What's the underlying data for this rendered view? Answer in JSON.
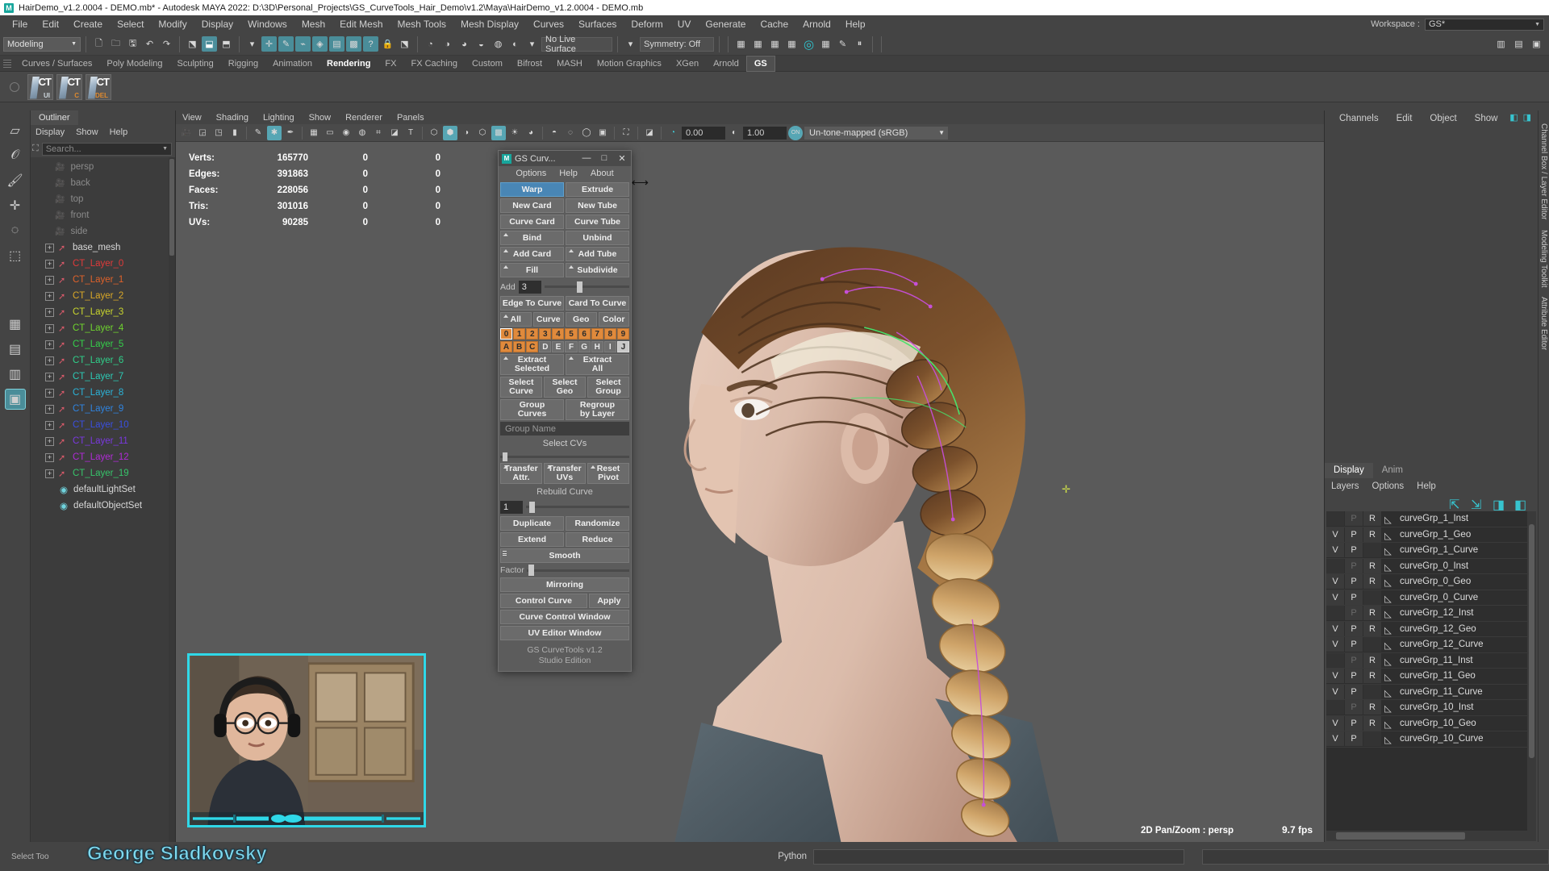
{
  "titlebar": {
    "text": "HairDemo_v1.2.0004 - DEMO.mb* - Autodesk MAYA 2022: D:\\3D\\Personal_Projects\\GS_CurveTools_Hair_Demo\\v1.2\\Maya\\HairDemo_v1.2.0004 - DEMO.mb",
    "logo": "M"
  },
  "menubar": {
    "items": [
      "File",
      "Edit",
      "Create",
      "Select",
      "Modify",
      "Display",
      "Windows",
      "Mesh",
      "Edit Mesh",
      "Mesh Tools",
      "Mesh Display",
      "Curves",
      "Surfaces",
      "Deform",
      "UV",
      "Generate",
      "Cache",
      "Arnold",
      "Help"
    ],
    "workspace_label": "Workspace :",
    "workspace_value": "GS*"
  },
  "toolbar": {
    "mode": "Modeling",
    "live_surface": "No Live Surface",
    "symmetry": "Symmetry: Off"
  },
  "shelf": {
    "tabs": [
      "Curves / Surfaces",
      "Poly Modeling",
      "Sculpting",
      "Rigging",
      "Animation",
      "Rendering",
      "FX",
      "FX Caching",
      "Custom",
      "Bifrost",
      "MASH",
      "Motion Graphics",
      "XGen",
      "Arnold",
      "GS"
    ],
    "active": "GS",
    "bold": "Rendering",
    "buttons": [
      {
        "name": "CT",
        "sub": "UI"
      },
      {
        "name": "CT",
        "sub": "C"
      },
      {
        "name": "CT",
        "sub": "DEL"
      }
    ]
  },
  "outliner": {
    "tab": "Outliner",
    "menus": [
      "Display",
      "Show",
      "Help"
    ],
    "search_placeholder": "Search...",
    "items": [
      {
        "label": "persp",
        "type": "camera",
        "color": "#8b8b8b"
      },
      {
        "label": "back",
        "type": "camera",
        "color": "#8b8b8b"
      },
      {
        "label": "top",
        "type": "camera",
        "color": "#8b8b8b"
      },
      {
        "label": "front",
        "type": "camera",
        "color": "#8b8b8b"
      },
      {
        "label": "side",
        "type": "camera",
        "color": "#8b8b8b"
      },
      {
        "label": "base_mesh",
        "type": "transform",
        "color": "#d8d8d8"
      },
      {
        "label": "CT_Layer_0",
        "type": "transform",
        "color": "#e03a3a"
      },
      {
        "label": "CT_Layer_1",
        "type": "transform",
        "color": "#e0622a"
      },
      {
        "label": "CT_Layer_2",
        "type": "transform",
        "color": "#d9a727"
      },
      {
        "label": "CT_Layer_3",
        "type": "transform",
        "color": "#c9d62e"
      },
      {
        "label": "CT_Layer_4",
        "type": "transform",
        "color": "#6fd42e"
      },
      {
        "label": "CT_Layer_5",
        "type": "transform",
        "color": "#34d04a"
      },
      {
        "label": "CT_Layer_6",
        "type": "transform",
        "color": "#2fd08a"
      },
      {
        "label": "CT_Layer_7",
        "type": "transform",
        "color": "#2cc9b4"
      },
      {
        "label": "CT_Layer_8",
        "type": "transform",
        "color": "#2bb3d8"
      },
      {
        "label": "CT_Layer_9",
        "type": "transform",
        "color": "#2f84e0"
      },
      {
        "label": "CT_Layer_10",
        "type": "transform",
        "color": "#3a4fe0"
      },
      {
        "label": "CT_Layer_11",
        "type": "transform",
        "color": "#7a38e0"
      },
      {
        "label": "CT_Layer_12",
        "type": "transform",
        "color": "#b02ad6"
      },
      {
        "label": "CT_Layer_19",
        "type": "transform",
        "color": "#37c46a"
      },
      {
        "label": "defaultLightSet",
        "type": "set",
        "color": "#d8d8d8"
      },
      {
        "label": "defaultObjectSet",
        "type": "set",
        "color": "#d8d8d8"
      }
    ]
  },
  "viewport": {
    "menus": [
      "View",
      "Shading",
      "Lighting",
      "Show",
      "Renderer",
      "Panels"
    ],
    "exposure": "0.00",
    "gamma": "1.00",
    "tonemap_toggle": "ON",
    "tonemap": "Un-tone-mapped (sRGB)",
    "hud_headers": [
      "",
      "",
      ""
    ],
    "hud": [
      {
        "label": "Verts:",
        "total": "165770",
        "b": "0",
        "c": "0"
      },
      {
        "label": "Edges:",
        "total": "391863",
        "b": "0",
        "c": "0"
      },
      {
        "label": "Faces:",
        "total": "228056",
        "b": "0",
        "c": "0"
      },
      {
        "label": "Tris:",
        "total": "301016",
        "b": "0",
        "c": "0"
      },
      {
        "label": "UVs:",
        "total": "90285",
        "b": "0",
        "c": "0"
      }
    ],
    "panzoom": "2D Pan/Zoom : persp",
    "fps": "9.7 fps"
  },
  "gs_curvetools": {
    "title": "GS Curv...",
    "logo": "M",
    "window_buttons": [
      "—",
      "□",
      "✕"
    ],
    "menus": [
      "Options",
      "Help",
      "About"
    ],
    "rows": [
      {
        "type": "pair",
        "left": {
          "label": "Warp",
          "style": "blue"
        },
        "right": {
          "label": "Extrude"
        }
      },
      {
        "type": "pair",
        "left": {
          "label": "New Card"
        },
        "right": {
          "label": "New Tube"
        }
      },
      {
        "type": "pair",
        "left": {
          "label": "Curve Card"
        },
        "right": {
          "label": "Curve Tube"
        }
      },
      {
        "type": "pair",
        "left": {
          "label": "Bind",
          "opt": true
        },
        "right": {
          "label": "Unbind"
        }
      },
      {
        "type": "pair",
        "left": {
          "label": "Add Card",
          "opt": true
        },
        "right": {
          "label": "Add Tube",
          "opt": true
        }
      },
      {
        "type": "pair",
        "left": {
          "label": "Fill",
          "opt": true
        },
        "right": {
          "label": "Subdivide",
          "opt": true
        }
      }
    ],
    "add_label": "Add",
    "add_value": "3",
    "curve_row": [
      {
        "label": "Edge To Curve"
      },
      {
        "label": "Card To Curve"
      }
    ],
    "filter_row": [
      {
        "label": "All",
        "opt": true
      },
      {
        "label": "Curve"
      },
      {
        "label": "Geo"
      },
      {
        "label": "Color"
      }
    ],
    "digits": [
      "0",
      "1",
      "2",
      "3",
      "4",
      "5",
      "6",
      "7",
      "8",
      "9"
    ],
    "digit_states": [
      "sel",
      "on",
      "on",
      "on",
      "on",
      "on",
      "on",
      "on",
      "on",
      "on"
    ],
    "letters": [
      "A",
      "B",
      "C",
      "D",
      "E",
      "F",
      "G",
      "H",
      "I",
      "J"
    ],
    "letter_states": [
      "on",
      "on",
      "on",
      "off",
      "off",
      "off",
      "off",
      "off",
      "off",
      "white"
    ],
    "extract_row": [
      {
        "l1": "Extract",
        "l2": "Selected"
      },
      {
        "l1": "Extract",
        "l2": "All"
      }
    ],
    "select_row": [
      {
        "l1": "Select",
        "l2": "Curve"
      },
      {
        "l1": "Select",
        "l2": "Geo"
      },
      {
        "l1": "Select",
        "l2": "Group"
      }
    ],
    "group_row": [
      {
        "l1": "Group",
        "l2": "Curves"
      },
      {
        "l1": "Regroup",
        "l2": "by Layer"
      }
    ],
    "group_name_placeholder": "Group Name",
    "select_cvs": "Select CVs",
    "transfer_row": [
      {
        "l1": "Transfer",
        "l2": "Attr."
      },
      {
        "l1": "Transfer",
        "l2": "UVs"
      },
      {
        "l1": "Reset",
        "l2": "Pivot"
      }
    ],
    "rebuild_label": "Rebuild Curve",
    "rebuild_value": "1",
    "dup_row": [
      {
        "label": "Duplicate"
      },
      {
        "label": "Randomize"
      }
    ],
    "ext_row": [
      {
        "label": "Extend"
      },
      {
        "label": "Reduce"
      }
    ],
    "smooth": "Smooth",
    "factor_label": "Factor",
    "mirroring": "Mirroring",
    "control_curve": "Control Curve",
    "apply": "Apply",
    "curve_control_window": "Curve Control Window",
    "uv_editor_window": "UV Editor Window",
    "footer_line1": "GS CurveTools v1.2",
    "footer_line2": "Studio Edition"
  },
  "right_dock": {
    "tabs": [
      "Channels",
      "Edit",
      "Object",
      "Show"
    ],
    "vertical_tabs": [
      "Channel Box / Layer Editor",
      "Modeling Toolkit",
      "Attribute Editor"
    ],
    "display_tabs": [
      "Display",
      "Anim"
    ],
    "display_active": "Display",
    "layer_menus": [
      "Layers",
      "Options",
      "Help"
    ],
    "layers": [
      {
        "v": "",
        "p": "P",
        "r": "R",
        "name": "curveGrp_1_Inst",
        "dim": true
      },
      {
        "v": "V",
        "p": "P",
        "r": "R",
        "name": "curveGrp_1_Geo"
      },
      {
        "v": "V",
        "p": "P",
        "r": "",
        "name": "curveGrp_1_Curve"
      },
      {
        "v": "",
        "p": "P",
        "r": "R",
        "name": "curveGrp_0_Inst",
        "dim": true
      },
      {
        "v": "V",
        "p": "P",
        "r": "R",
        "name": "curveGrp_0_Geo"
      },
      {
        "v": "V",
        "p": "P",
        "r": "",
        "name": "curveGrp_0_Curve"
      },
      {
        "v": "",
        "p": "P",
        "r": "R",
        "name": "curveGrp_12_Inst",
        "dim": true
      },
      {
        "v": "V",
        "p": "P",
        "r": "R",
        "name": "curveGrp_12_Geo"
      },
      {
        "v": "V",
        "p": "P",
        "r": "",
        "name": "curveGrp_12_Curve"
      },
      {
        "v": "",
        "p": "P",
        "r": "R",
        "name": "curveGrp_11_Inst",
        "dim": true
      },
      {
        "v": "V",
        "p": "P",
        "r": "R",
        "name": "curveGrp_11_Geo"
      },
      {
        "v": "V",
        "p": "P",
        "r": "",
        "name": "curveGrp_11_Curve"
      },
      {
        "v": "",
        "p": "P",
        "r": "R",
        "name": "curveGrp_10_Inst",
        "dim": true
      },
      {
        "v": "V",
        "p": "P",
        "r": "R",
        "name": "curveGrp_10_Geo"
      },
      {
        "v": "V",
        "p": "P",
        "r": "",
        "name": "curveGrp_10_Curve"
      }
    ]
  },
  "statusbar": {
    "tool": "Select Too",
    "python_label": "Python",
    "overlay_name": "George Sladkovsky"
  },
  "colors": {
    "accent_blue": "#4986b5",
    "orange": "#e08a3c",
    "teal": "#37c4cf",
    "webcam_border": "#2fd8e8",
    "bg": "#444444"
  }
}
